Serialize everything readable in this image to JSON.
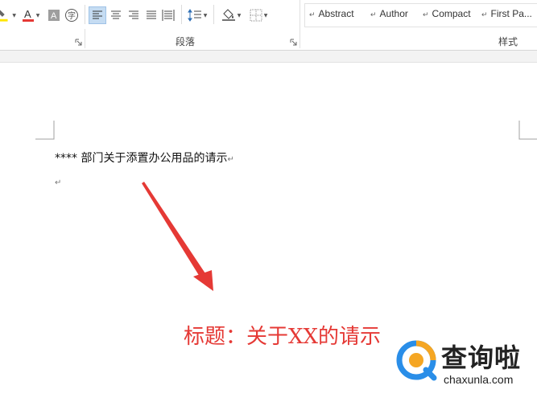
{
  "ribbon": {
    "paragraph_group_label": "段落",
    "styles_group_label": "样式",
    "phonetic_glyph": "字",
    "styles": [
      {
        "label": "Abstract"
      },
      {
        "label": "Author"
      },
      {
        "label": "Compact"
      },
      {
        "label": "First Pa..."
      }
    ],
    "colors": {
      "font_color": "#e53935",
      "highlight": "#ffe600",
      "active_button": "#c5dcf2"
    }
  },
  "document": {
    "line1": "**** 部门关于添置办公用品的请示",
    "paragraph_mark": "↵"
  },
  "annotation": {
    "text": "标题：关于XX的请示",
    "color": "#e53935"
  },
  "watermark": {
    "name": "查询啦",
    "url": "chaxunla.com"
  }
}
